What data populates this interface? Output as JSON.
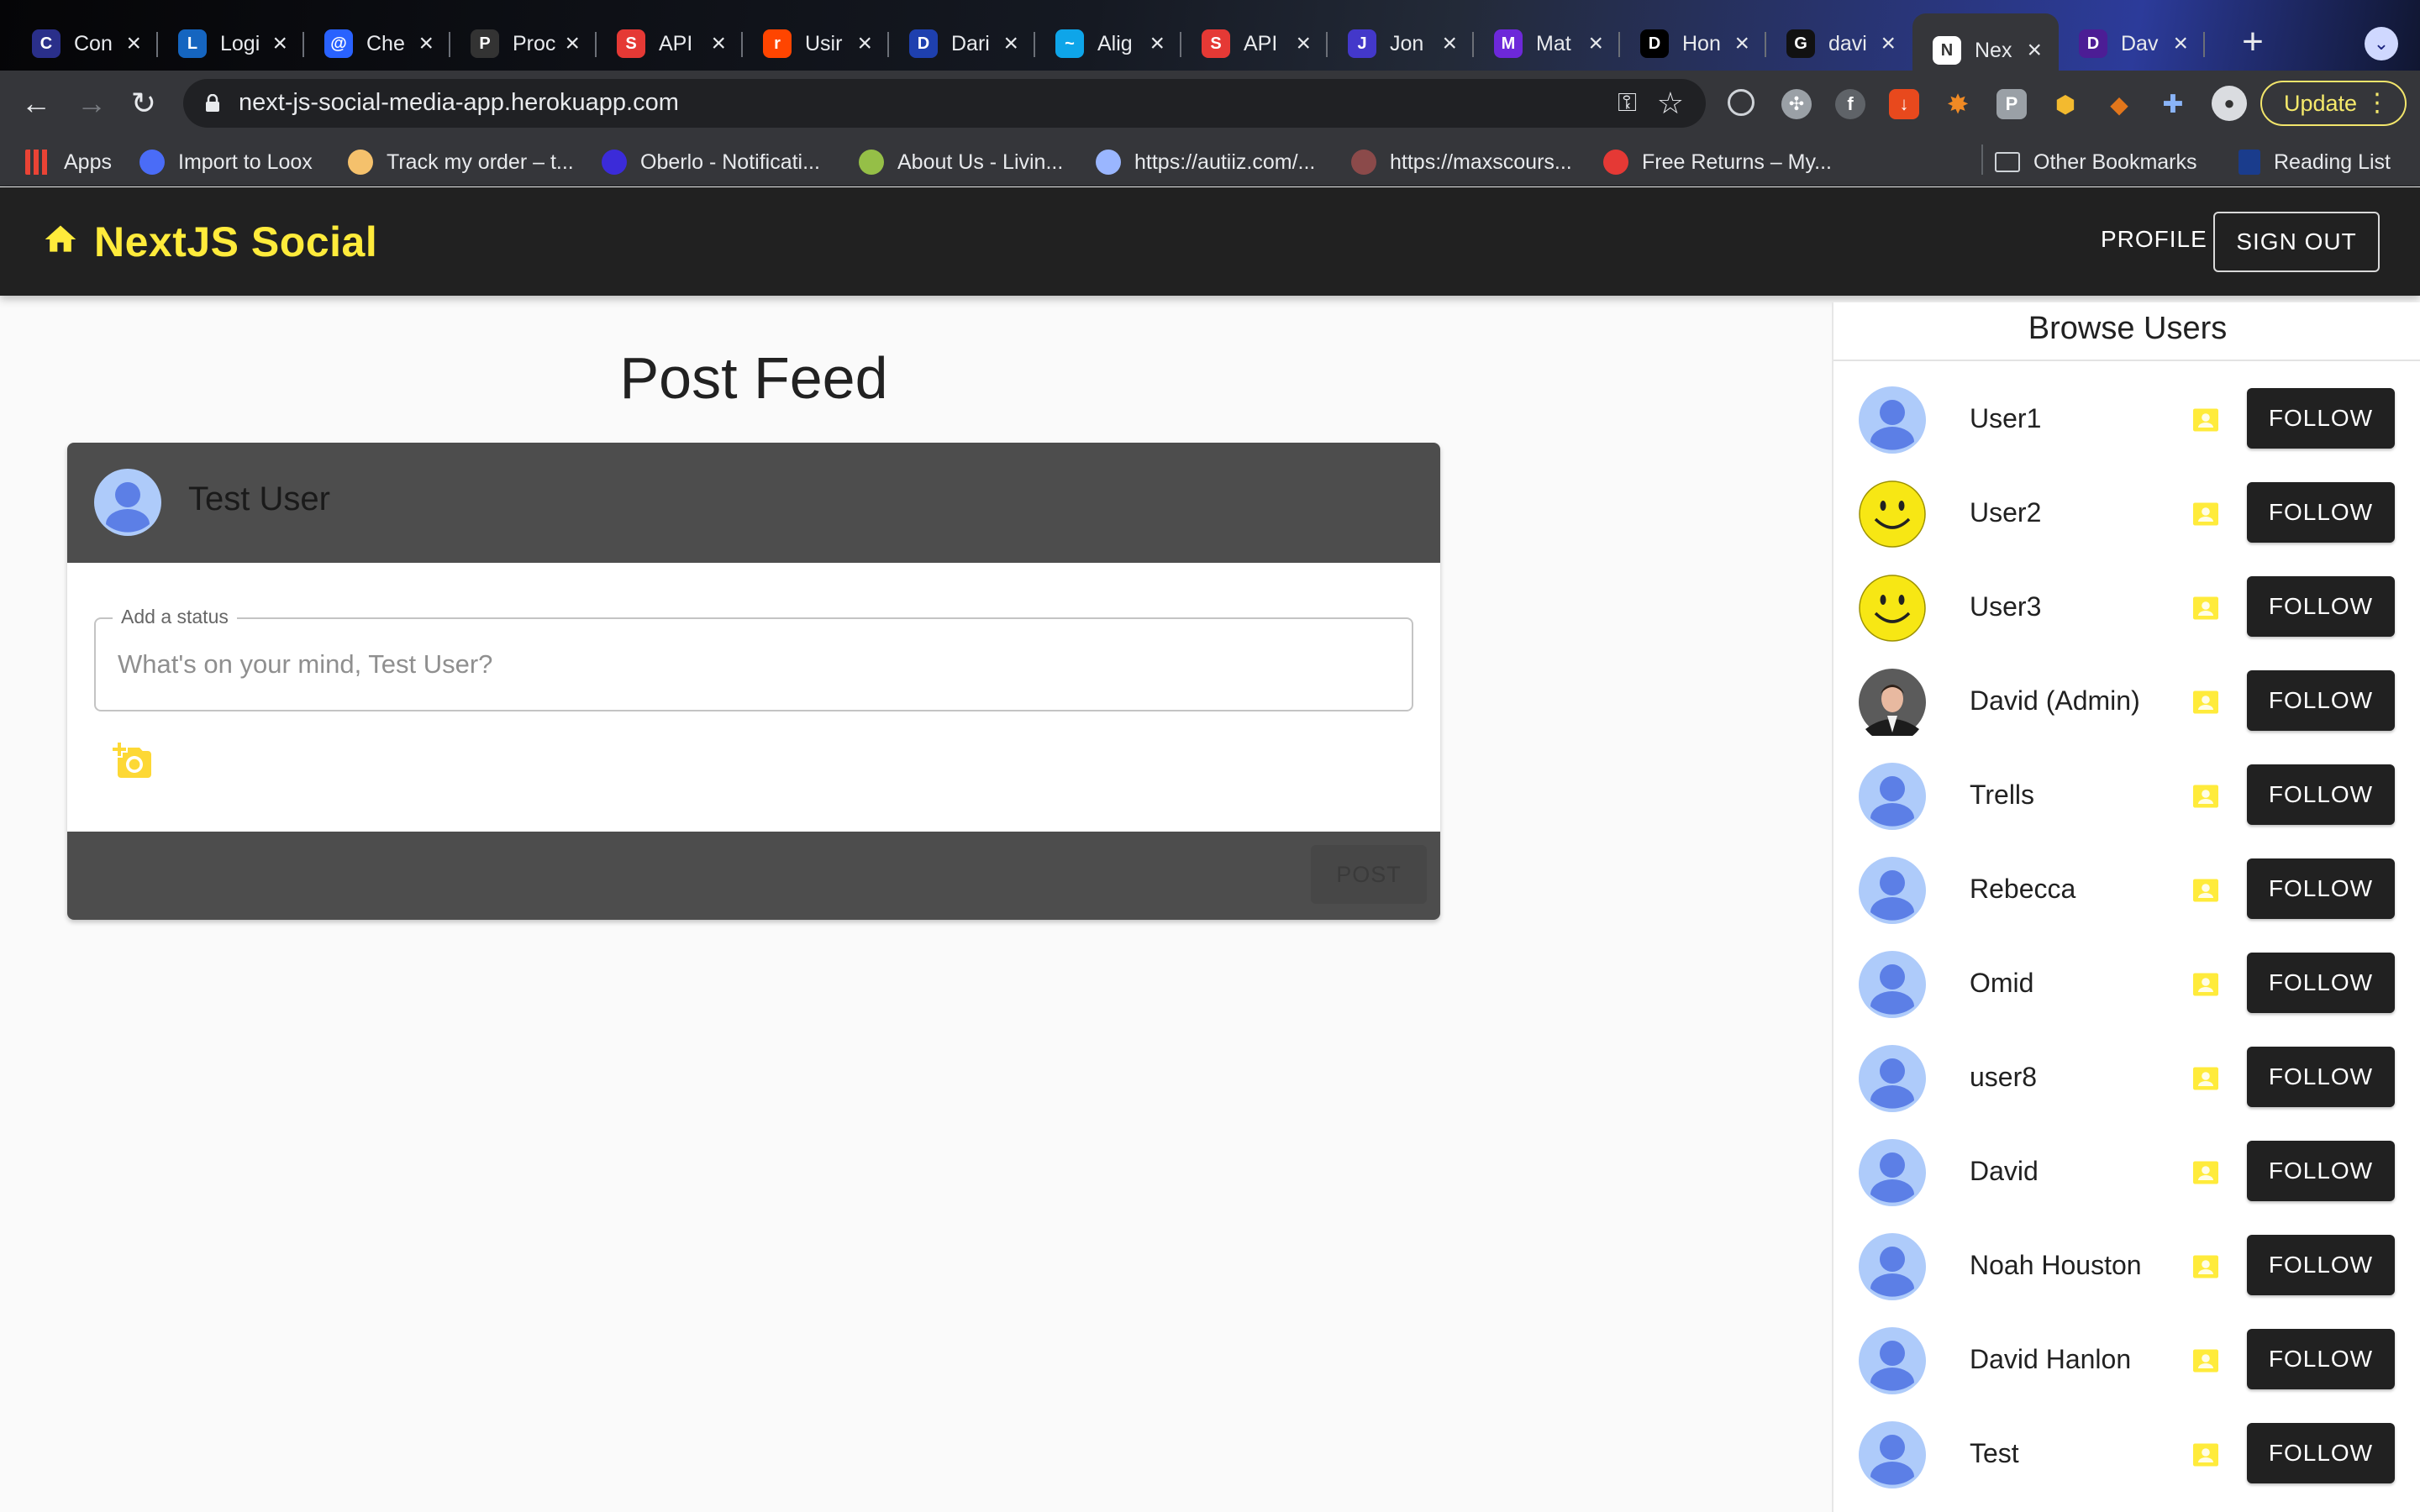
{
  "browser": {
    "tabs": [
      {
        "title": "Con",
        "favicon": "C",
        "color": "#2a2f8a"
      },
      {
        "title": "Logi",
        "favicon": "L",
        "color": "#1565c0"
      },
      {
        "title": "Che",
        "favicon": "@",
        "color": "#2962ff"
      },
      {
        "title": "Proc",
        "favicon": "P",
        "color": "#333333"
      },
      {
        "title": "API",
        "favicon": "S",
        "color": "#e53935"
      },
      {
        "title": "Usir",
        "favicon": "r",
        "color": "#ff4500"
      },
      {
        "title": "Dari",
        "favicon": "D",
        "color": "#1e40af"
      },
      {
        "title": "Alig",
        "favicon": "~",
        "color": "#0ea5e9"
      },
      {
        "title": "API",
        "favicon": "S",
        "color": "#e53935"
      },
      {
        "title": "Jon",
        "favicon": "J",
        "color": "#4338ca"
      },
      {
        "title": "Mat",
        "favicon": "M",
        "color": "#6d28d9"
      },
      {
        "title": "Hon",
        "favicon": "D",
        "color": "#000000"
      },
      {
        "title": "davi",
        "favicon": "G",
        "color": "#111111"
      },
      {
        "title": "Nex",
        "favicon": "N",
        "color": "#ffffff"
      },
      {
        "title": "Dav",
        "favicon": "D",
        "color": "#4c1d95"
      }
    ],
    "active_tab": 13,
    "url": "next-js-social-media-app.herokuapp.com",
    "update_label": "Update",
    "bookmarks": [
      {
        "label": "Apps",
        "icon": "apps-grid-icon",
        "color": "#ea4335"
      },
      {
        "label": "Import to Loox",
        "icon": "globe-icon",
        "color": "#4a6cf7"
      },
      {
        "label": "Track my order – t...",
        "icon": "track-order-icon",
        "color": "#f5c16c"
      },
      {
        "label": "Oberlo - Notificati...",
        "icon": "oberlo-icon",
        "color": "#3b2bd9"
      },
      {
        "label": "About Us - Livin...",
        "icon": "shopify-icon",
        "color": "#95bf47"
      },
      {
        "label": "https://autiiz.com/...",
        "icon": "autiiz-icon",
        "color": "#9ab6ff"
      },
      {
        "label": "https://maxscours...",
        "icon": "maxscours-icon",
        "color": "#8b4a4a"
      },
      {
        "label": "Free Returns – My...",
        "icon": "returns-icon",
        "color": "#e53935"
      }
    ],
    "other_bookmarks": "Other Bookmarks",
    "reading_list": "Reading List"
  },
  "appbar": {
    "brand": "NextJS Social",
    "profile": "PROFILE",
    "signout": "SIGN OUT"
  },
  "feed": {
    "title": "Post Feed",
    "user": "Test User",
    "status_label": "Add a status",
    "status_placeholder": "What's on your mind, Test User?",
    "post_button": "POST"
  },
  "sidebar": {
    "title": "Browse Users",
    "follow_label": "FOLLOW",
    "users": [
      {
        "name": "User1",
        "avatar": "default"
      },
      {
        "name": "User2",
        "avatar": "smiley"
      },
      {
        "name": "User3",
        "avatar": "smiley"
      },
      {
        "name": "David (Admin)",
        "avatar": "photo"
      },
      {
        "name": "Trells",
        "avatar": "default"
      },
      {
        "name": "Rebecca",
        "avatar": "default"
      },
      {
        "name": "Omid",
        "avatar": "default"
      },
      {
        "name": "user8",
        "avatar": "default"
      },
      {
        "name": "David",
        "avatar": "default"
      },
      {
        "name": "Noah Houston",
        "avatar": "default"
      },
      {
        "name": "David Hanlon",
        "avatar": "default"
      },
      {
        "name": "Test",
        "avatar": "default"
      }
    ]
  },
  "colors": {
    "accent_yellow": "#ffeb3b",
    "appbar_bg": "#212121",
    "card_header_bg": "#4d4d4d",
    "avatar_blue": "#5c7fe6"
  }
}
